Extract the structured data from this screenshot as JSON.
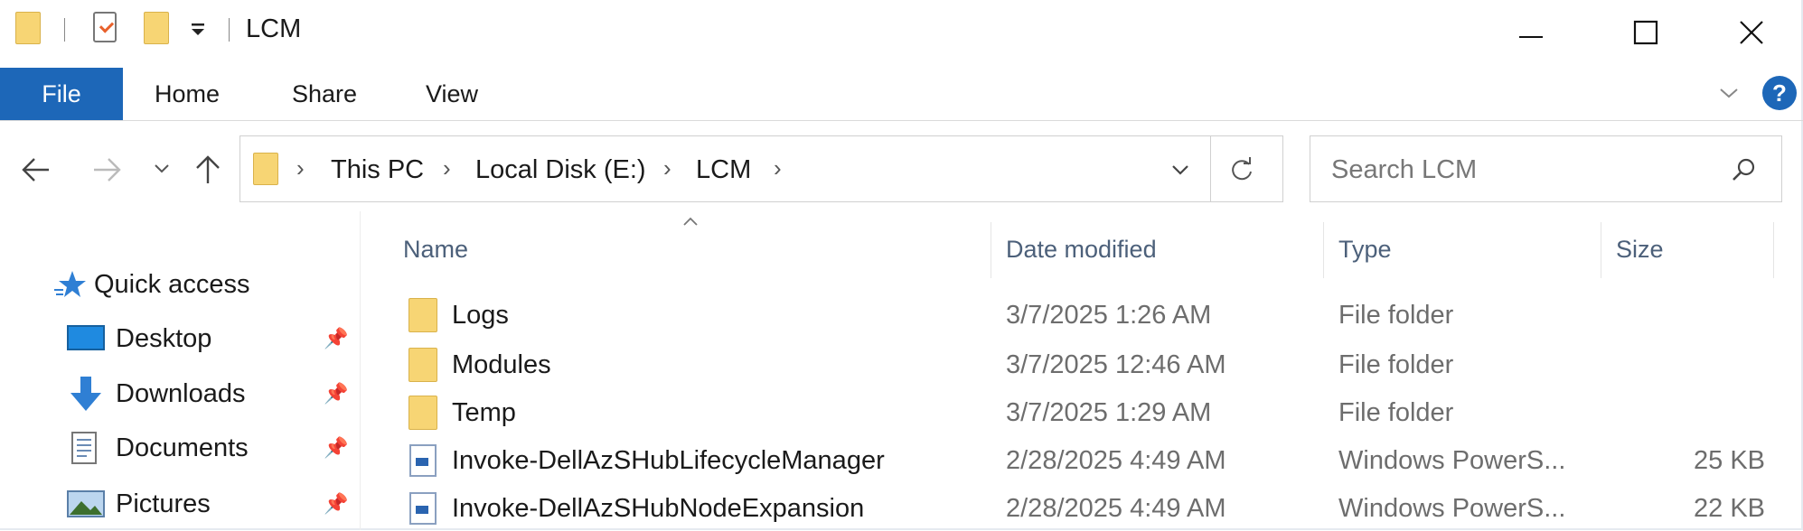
{
  "window": {
    "title": "LCM"
  },
  "ribbon": {
    "tabs": [
      "File",
      "Home",
      "Share",
      "View"
    ],
    "help_label": "?"
  },
  "address": {
    "segments": [
      "This PC",
      "Local Disk (E:)",
      "LCM"
    ]
  },
  "search": {
    "placeholder": "Search LCM"
  },
  "columns": {
    "name": "Name",
    "date": "Date modified",
    "type": "Type",
    "size": "Size"
  },
  "nav": {
    "quick_access": "Quick access",
    "items": [
      {
        "label": "Desktop"
      },
      {
        "label": "Downloads"
      },
      {
        "label": "Documents"
      },
      {
        "label": "Pictures"
      }
    ]
  },
  "files": [
    {
      "name": "Logs",
      "date": "3/7/2025 1:26 AM",
      "type": "File folder",
      "size": "",
      "icon": "folder-icon"
    },
    {
      "name": "Modules",
      "date": "3/7/2025 12:46 AM",
      "type": "File folder",
      "size": "",
      "icon": "folder-icon"
    },
    {
      "name": "Temp",
      "date": "3/7/2025 1:29 AM",
      "type": "File folder",
      "size": "",
      "icon": "folder-icon"
    },
    {
      "name": "Invoke-DellAzSHubLifecycleManager",
      "date": "2/28/2025 4:49 AM",
      "type": "Windows PowerS...",
      "size": "25 KB",
      "icon": "powershell-script-icon"
    },
    {
      "name": "Invoke-DellAzSHubNodeExpansion",
      "date": "2/28/2025 4:49 AM",
      "type": "Windows PowerS...",
      "size": "22 KB",
      "icon": "powershell-script-icon"
    }
  ],
  "colors": {
    "accent": "#1d67b8",
    "folder": "#f7d574",
    "header_text": "#4c607a"
  }
}
